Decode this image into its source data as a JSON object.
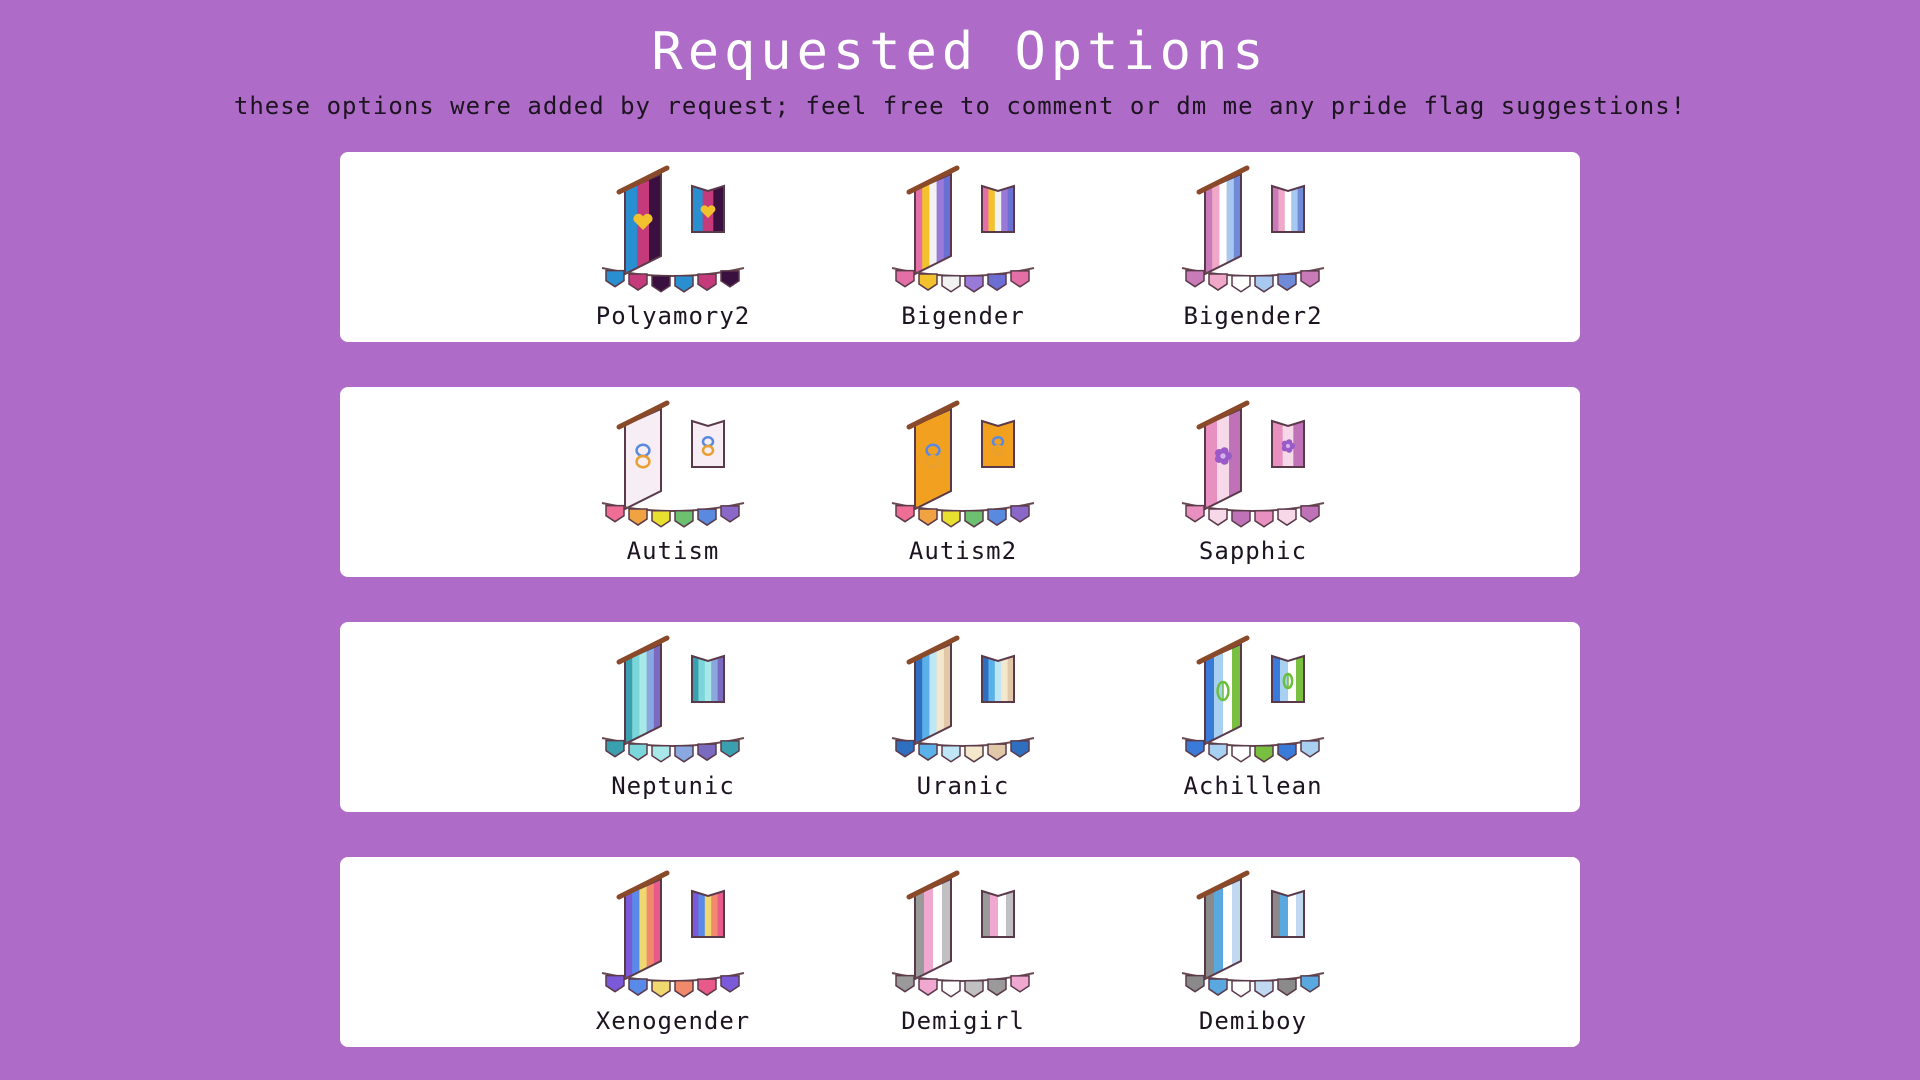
{
  "header": {
    "title": "Requested Options",
    "subtitle": "these options were added by request; feel free to comment or dm me any pride flag suggestions!"
  },
  "rows": [
    {
      "items": [
        {
          "label": "Polyamory2",
          "colors": [
            "#2a8fd0",
            "#c43a7a",
            "#3a1040"
          ],
          "icon": "heart-icon"
        },
        {
          "label": "Bigender",
          "colors": [
            "#e46fa6",
            "#f2c12e",
            "#f2f2f2",
            "#9a7ad8",
            "#6b6fd4"
          ],
          "icon": "none"
        },
        {
          "label": "Bigender2",
          "colors": [
            "#c97ab8",
            "#f0a8c8",
            "#ffffff",
            "#a8c8f0",
            "#6f8ad8"
          ],
          "icon": "none"
        }
      ]
    },
    {
      "items": [
        {
          "label": "Autism",
          "colors": [
            "#ee6e96",
            "#f0a340",
            "#e8e030",
            "#6cc070",
            "#5a8ae0",
            "#8a68c8"
          ],
          "icon": "infinity-icon",
          "bg": "#f6eef4"
        },
        {
          "label": "Autism2",
          "colors": [
            "#ee6e96",
            "#f0a340",
            "#e8e030",
            "#6cc070",
            "#5a8ae0",
            "#8a68c8"
          ],
          "icon": "infinity-icon",
          "bg": "#f2a020"
        },
        {
          "label": "Sapphic",
          "colors": [
            "#e890c0",
            "#f6d8e8",
            "#c072b8"
          ],
          "icon": "flower-icon"
        }
      ]
    },
    {
      "items": [
        {
          "label": "Neptunic",
          "colors": [
            "#3aa0b0",
            "#7ad6d8",
            "#a8e8e8",
            "#8aa8e0",
            "#7a6ac0"
          ],
          "icon": "none"
        },
        {
          "label": "Uranic",
          "colors": [
            "#2f6fc0",
            "#5ab0e8",
            "#bfe6f5",
            "#f4e8cc",
            "#e0c8a8"
          ],
          "icon": "none"
        },
        {
          "label": "Achillean",
          "colors": [
            "#3a7ad8",
            "#a8d0f0",
            "#ffffff",
            "#7ac040"
          ],
          "icon": "leaf-icon"
        }
      ]
    },
    {
      "items": [
        {
          "label": "Xenogender",
          "colors": [
            "#7a5ad8",
            "#5a8ae8",
            "#f0d870",
            "#f08a6a",
            "#e85a8a"
          ],
          "icon": "none"
        },
        {
          "label": "Demigirl",
          "colors": [
            "#9a9a9a",
            "#f0a8d0",
            "#ffffff",
            "#c0c0c0"
          ],
          "icon": "none"
        },
        {
          "label": "Demiboy",
          "colors": [
            "#8a8a8a",
            "#5aa8e0",
            "#ffffff",
            "#c0d8f0"
          ],
          "icon": "none"
        }
      ]
    }
  ]
}
